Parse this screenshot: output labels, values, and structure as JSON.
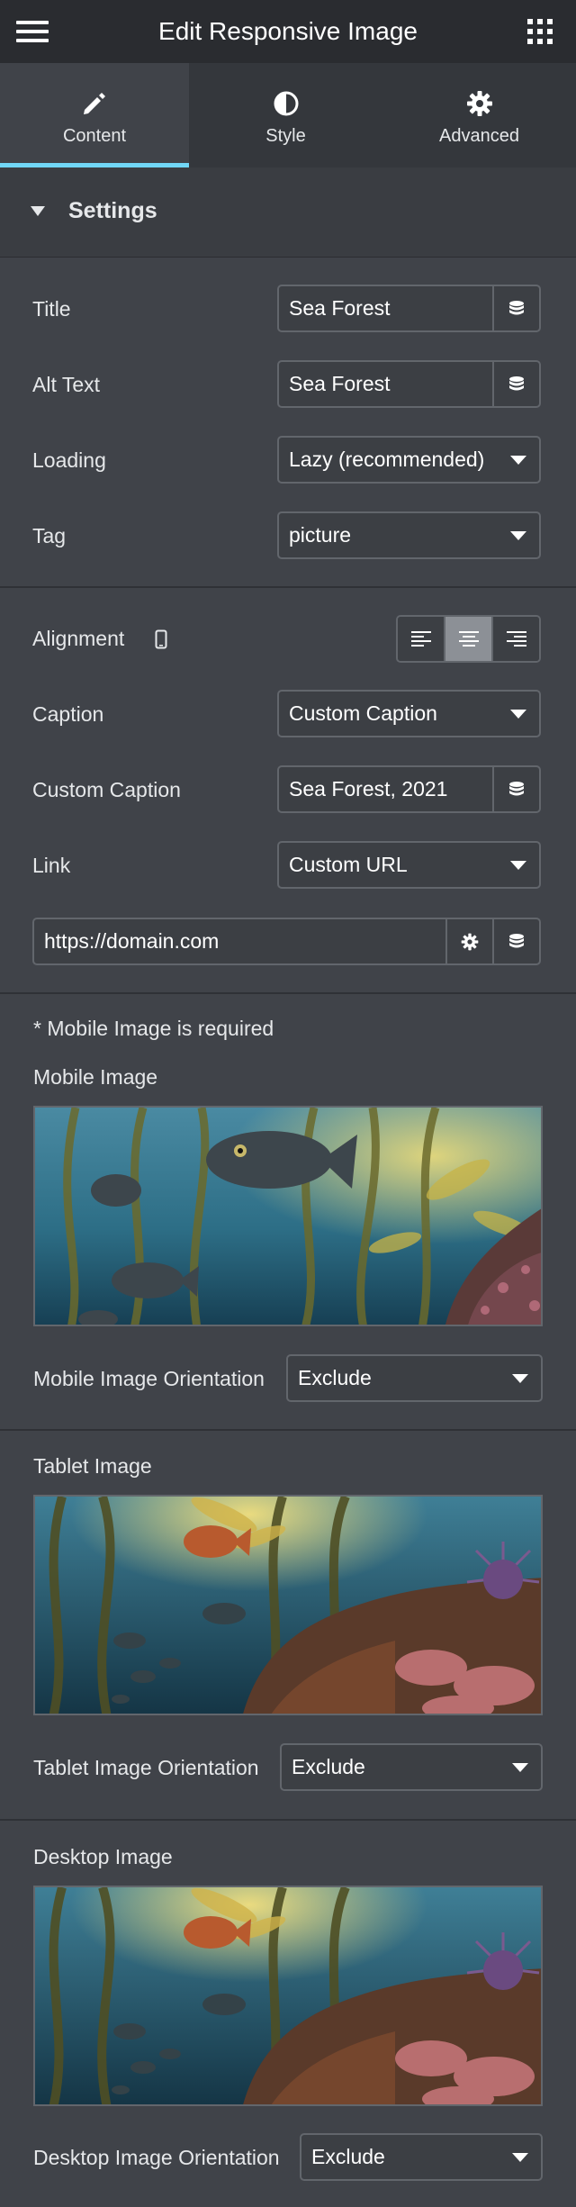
{
  "header": {
    "title": "Edit Responsive Image",
    "menu_icon": "hamburger-menu-icon",
    "apps_icon": "grid-apps-icon"
  },
  "tabs": [
    {
      "label": "Content",
      "icon": "pencil-icon",
      "active": true
    },
    {
      "label": "Style",
      "icon": "half-circle-icon",
      "active": false
    },
    {
      "label": "Advanced",
      "icon": "gear-icon",
      "active": false
    }
  ],
  "section": {
    "label": "Settings",
    "icon": "caret-down-icon"
  },
  "settings": {
    "title": {
      "label": "Title",
      "value": "Sea Forest"
    },
    "alt_text": {
      "label": "Alt Text",
      "value": "Sea Forest"
    },
    "loading": {
      "label": "Loading",
      "value": "Lazy (recommended)"
    },
    "tag": {
      "label": "Tag",
      "value": "picture"
    },
    "alignment": {
      "label": "Alignment",
      "device_icon": "mobile-device-icon",
      "options": [
        "left",
        "center",
        "right"
      ],
      "selected": "center"
    },
    "caption": {
      "label": "Caption",
      "value": "Custom Caption"
    },
    "custom_caption": {
      "label": "Custom Caption",
      "value": "Sea Forest, 2021"
    },
    "link": {
      "label": "Link",
      "value": "Custom URL"
    },
    "url": {
      "value": "https://domain.com"
    }
  },
  "images": {
    "required_note": "* Mobile Image is required",
    "mobile": {
      "label": "Mobile Image",
      "orientation_label": "Mobile Image Orientation",
      "orientation_value": "Exclude"
    },
    "tablet": {
      "label": "Tablet Image",
      "orientation_label": "Tablet Image Orientation",
      "orientation_value": "Exclude"
    },
    "desktop": {
      "label": "Desktop Image",
      "orientation_label": "Desktop Image Orientation",
      "orientation_value": "Exclude"
    }
  },
  "colors": {
    "panel_bg": "#404349",
    "header_bg": "#2a2c30",
    "active_tab_indicator": "#71d7f7",
    "field_border": "#62666c"
  }
}
